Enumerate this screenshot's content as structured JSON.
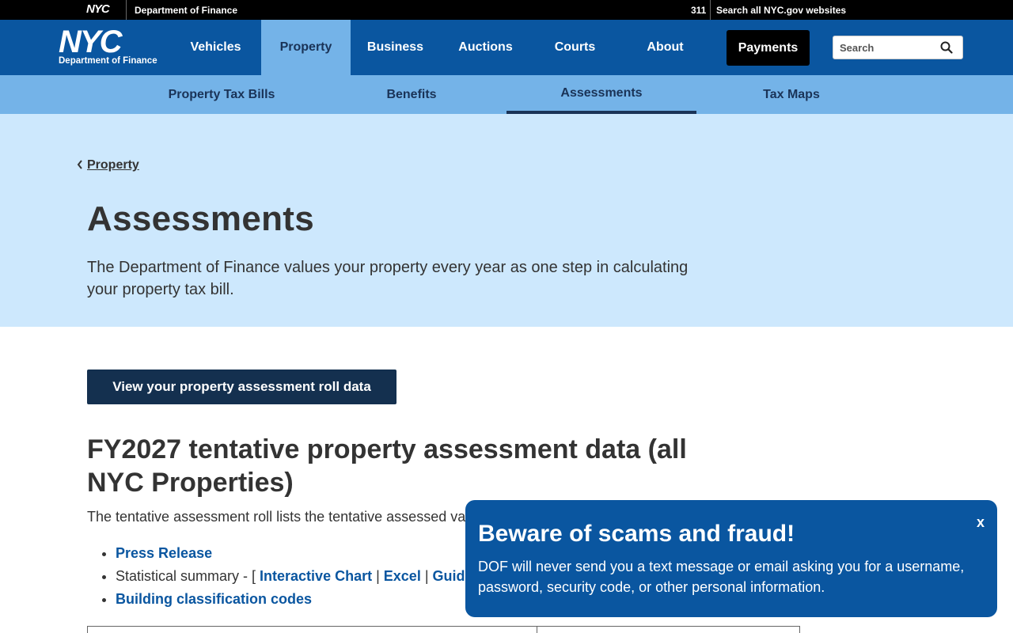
{
  "topbar": {
    "nyc_logo": "NYC",
    "department": "Department of Finance",
    "link_311": "311",
    "search_all": "Search all NYC.gov websites"
  },
  "logo": {
    "nyc": "NYC",
    "subtitle": "Department of Finance"
  },
  "nav": {
    "items": [
      {
        "label": "Vehicles"
      },
      {
        "label": "Property"
      },
      {
        "label": "Business"
      },
      {
        "label": "Auctions"
      },
      {
        "label": "Courts"
      },
      {
        "label": "About"
      }
    ],
    "active": "Property",
    "payments": "Payments",
    "search_placeholder": "Search"
  },
  "subnav": {
    "items": [
      {
        "label": "Property Tax Bills"
      },
      {
        "label": "Benefits"
      },
      {
        "label": "Assessments"
      },
      {
        "label": "Tax Maps"
      }
    ],
    "active": "Assessments"
  },
  "hero": {
    "breadcrumb": "Property",
    "title": "Assessments",
    "description": "The Department of Finance values your property every year as one step in calculating your property tax bill."
  },
  "content": {
    "cta_button": "View your property assessment roll data",
    "heading": "FY2027 tentative property assessment data (all NYC Properties)",
    "description": "The tentative assessment roll lists the tentative assessed va",
    "list": {
      "press_release": "Press Release",
      "statistical_summary_prefix": "Statistical summary - [ ",
      "interactive_chart": "Interactive Chart",
      "sep1": " | ",
      "excel": "Excel",
      "sep2": " | ",
      "guide": "Guid",
      "building_codes": "Building classification codes"
    }
  },
  "alert": {
    "title": "Beware of scams and fraud!",
    "message": "DOF will never send you a text message or email asking you for a username, password, security code, or other personal information.",
    "close": "x"
  },
  "colors": {
    "nav_blue": "#0a56a0",
    "subnav_blue": "#74b3e8",
    "hero_bg": "#cde8fd",
    "dark_navy": "#14304f"
  }
}
